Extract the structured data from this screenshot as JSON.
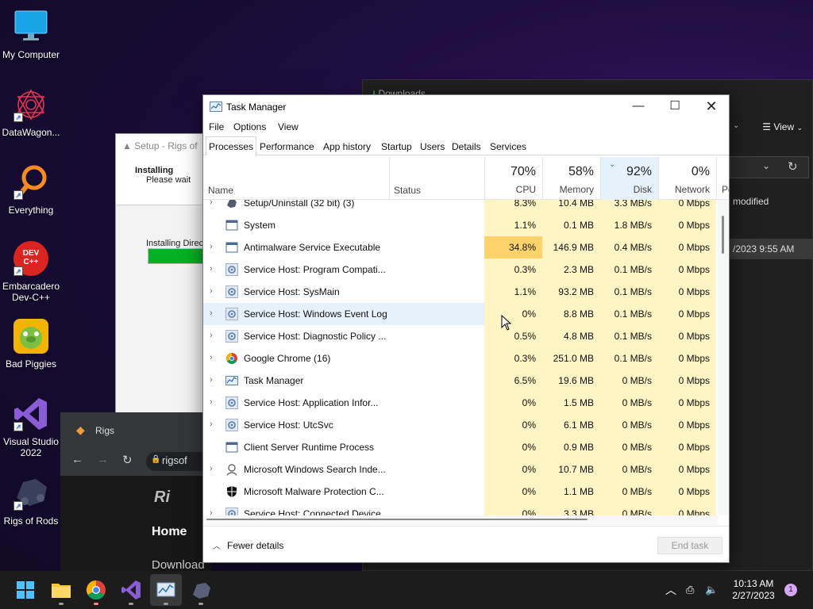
{
  "desktop": {
    "icons": [
      {
        "label": "My Computer",
        "icon": "monitor-icon"
      },
      {
        "label": "DataWagon...",
        "icon": "datawagon-icon"
      },
      {
        "label": "Everything",
        "icon": "search-magnifier-icon"
      },
      {
        "label": "Embarcadero Dev-C++",
        "icon": "devcpp-icon",
        "badge": "DEV C++"
      },
      {
        "label": "Bad Piggies",
        "icon": "bad-piggies-icon"
      },
      {
        "label": "Visual Studio 2022",
        "icon": "visual-studio-icon"
      },
      {
        "label": "Rigs of Rods",
        "icon": "rigs-of-rods-icon"
      }
    ]
  },
  "downloads_window": {
    "title": "Downloads",
    "view_label": "View",
    "column_modified": "modified",
    "row_date": "/2023 9:55 AM"
  },
  "setup_window": {
    "title": "Setup - Rigs of",
    "heading": "Installing",
    "subtext": "Please wait wh",
    "status": "Installing Direc",
    "progress": 1.0
  },
  "browser_window": {
    "tab_label": "Rigs",
    "url": "rigsof",
    "site_logo": "Ri",
    "nav_home": "Home",
    "nav_download": "Download"
  },
  "task_manager": {
    "title": "Task Manager",
    "menu": [
      "File",
      "Options",
      "View"
    ],
    "tabs": [
      "Processes",
      "Performance",
      "App history",
      "Startup",
      "Users",
      "Details",
      "Services"
    ],
    "active_tab": "Processes",
    "columns": {
      "name": "Name",
      "status": "Status",
      "cpu": {
        "pct": "70%",
        "label": "CPU"
      },
      "memory": {
        "pct": "58%",
        "label": "Memory"
      },
      "disk": {
        "pct": "92%",
        "label": "Disk"
      },
      "network": {
        "pct": "0%",
        "label": "Network"
      },
      "power": "Po"
    },
    "processes": [
      {
        "name": "Setup/Uninstall (32 bit) (3)",
        "cpu": "8.3%",
        "mem": "10.4 MB",
        "disk": "3.3 MB/s",
        "net": "0 Mbps",
        "expand": true,
        "icon": "setup-icon"
      },
      {
        "name": "System",
        "cpu": "1.1%",
        "mem": "0.1 MB",
        "disk": "1.8 MB/s",
        "net": "0 Mbps",
        "expand": false,
        "icon": "window-icon"
      },
      {
        "name": "Antimalware Service Executable",
        "cpu": "34.8%",
        "mem": "146.9 MB",
        "disk": "0.4 MB/s",
        "net": "0 Mbps",
        "expand": true,
        "icon": "window-icon",
        "hot": true
      },
      {
        "name": "Service Host: Program Compati...",
        "cpu": "0.3%",
        "mem": "2.3 MB",
        "disk": "0.1 MB/s",
        "net": "0 Mbps",
        "expand": true,
        "icon": "gear-icon"
      },
      {
        "name": "Service Host: SysMain",
        "cpu": "1.1%",
        "mem": "93.2 MB",
        "disk": "0.1 MB/s",
        "net": "0 Mbps",
        "expand": true,
        "icon": "gear-icon"
      },
      {
        "name": "Service Host: Windows Event Log",
        "cpu": "0%",
        "mem": "8.8 MB",
        "disk": "0.1 MB/s",
        "net": "0 Mbps",
        "expand": true,
        "icon": "gear-icon",
        "selected": true
      },
      {
        "name": "Service Host: Diagnostic Policy ...",
        "cpu": "0.5%",
        "mem": "4.8 MB",
        "disk": "0.1 MB/s",
        "net": "0 Mbps",
        "expand": true,
        "icon": "gear-icon"
      },
      {
        "name": "Google Chrome (16)",
        "cpu": "0.3%",
        "mem": "251.0 MB",
        "disk": "0.1 MB/s",
        "net": "0 Mbps",
        "expand": true,
        "icon": "chrome-icon"
      },
      {
        "name": "Task Manager",
        "cpu": "6.5%",
        "mem": "19.6 MB",
        "disk": "0 MB/s",
        "net": "0 Mbps",
        "expand": true,
        "icon": "task-manager-icon"
      },
      {
        "name": "Service Host: Application Infor...",
        "cpu": "0%",
        "mem": "1.5 MB",
        "disk": "0 MB/s",
        "net": "0 Mbps",
        "expand": true,
        "icon": "gear-icon"
      },
      {
        "name": "Service Host: UtcSvc",
        "cpu": "0%",
        "mem": "6.1 MB",
        "disk": "0 MB/s",
        "net": "0 Mbps",
        "expand": true,
        "icon": "gear-icon"
      },
      {
        "name": "Client Server Runtime Process",
        "cpu": "0%",
        "mem": "0.9 MB",
        "disk": "0 MB/s",
        "net": "0 Mbps",
        "expand": false,
        "icon": "window-icon"
      },
      {
        "name": "Microsoft Windows Search Inde...",
        "cpu": "0%",
        "mem": "10.7 MB",
        "disk": "0 MB/s",
        "net": "0 Mbps",
        "expand": true,
        "icon": "search-indexer-icon"
      },
      {
        "name": "Microsoft Malware Protection C...",
        "cpu": "0%",
        "mem": "1.1 MB",
        "disk": "0 MB/s",
        "net": "0 Mbps",
        "expand": false,
        "icon": "shield-icon"
      },
      {
        "name": "Service Host: Connected Device...",
        "cpu": "0%",
        "mem": "3.3 MB",
        "disk": "0 MB/s",
        "net": "0 Mbps",
        "expand": true,
        "icon": "gear-icon"
      }
    ],
    "footer": {
      "fewer_details": "Fewer details",
      "end_task": "End task"
    }
  },
  "taskbar": {
    "apps": [
      "start-icon",
      "file-explorer-icon",
      "chrome-icon",
      "visual-studio-icon",
      "task-manager-icon",
      "rigs-of-rods-icon"
    ],
    "time": "10:13 AM",
    "date": "2/27/2023",
    "notifications": "1"
  },
  "colors": {
    "cpu_heat_low": "#fff4c4",
    "cpu_heat_high": "#ffd36b",
    "selection": "#e5f1fb",
    "accent": "#0067c0"
  }
}
